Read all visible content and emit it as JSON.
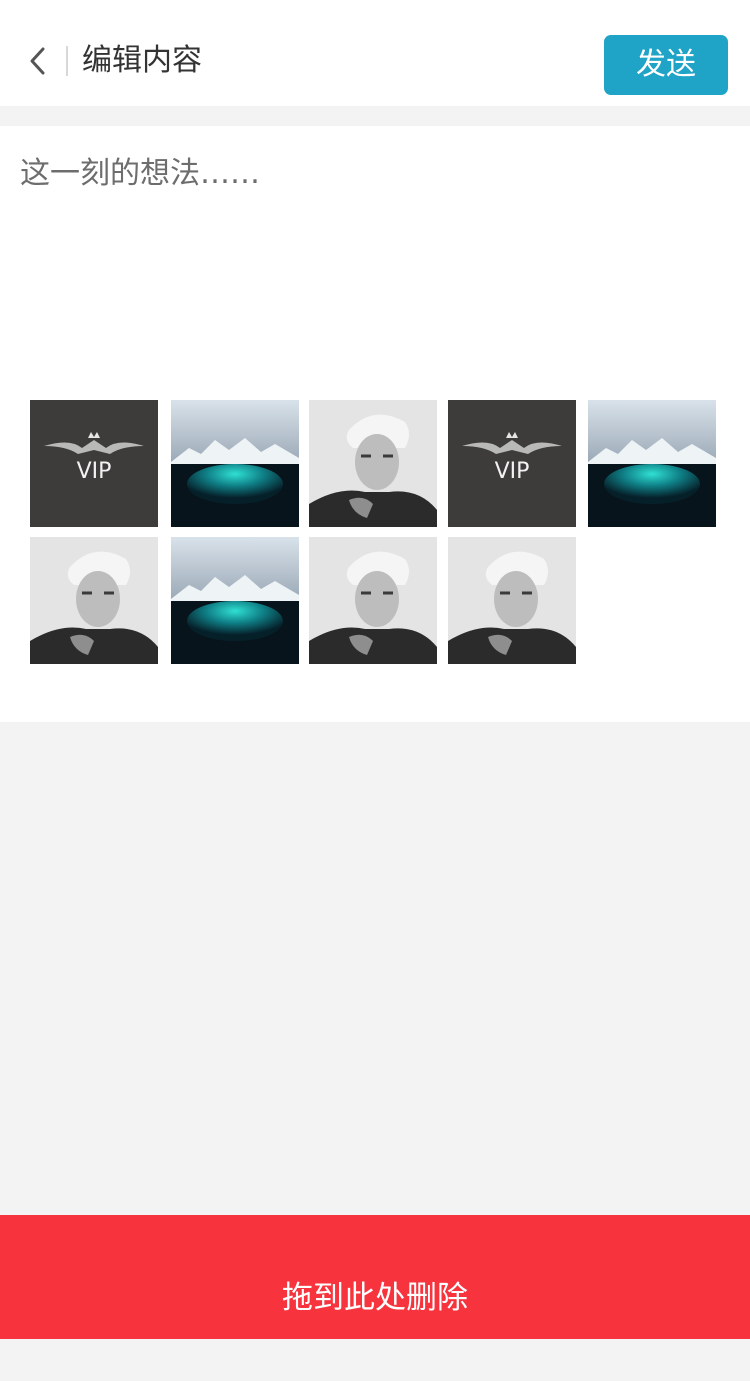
{
  "header": {
    "back_icon": "chevron-left-icon",
    "title": "编辑内容",
    "send_label": "发送",
    "send_color": "#1fa3c7"
  },
  "editor": {
    "placeholder": "这一刻的想法……",
    "value": ""
  },
  "photos": [
    {
      "kind": "vip-logo",
      "label": "VIP"
    },
    {
      "kind": "iceberg"
    },
    {
      "kind": "portrait"
    },
    {
      "kind": "vip-logo",
      "label": "VIP"
    },
    {
      "kind": "iceberg"
    },
    {
      "kind": "portrait"
    },
    {
      "kind": "iceberg"
    },
    {
      "kind": "portrait"
    },
    {
      "kind": "portrait"
    }
  ],
  "delete_zone": {
    "label": "拖到此处删除",
    "color": "#f7343e"
  }
}
